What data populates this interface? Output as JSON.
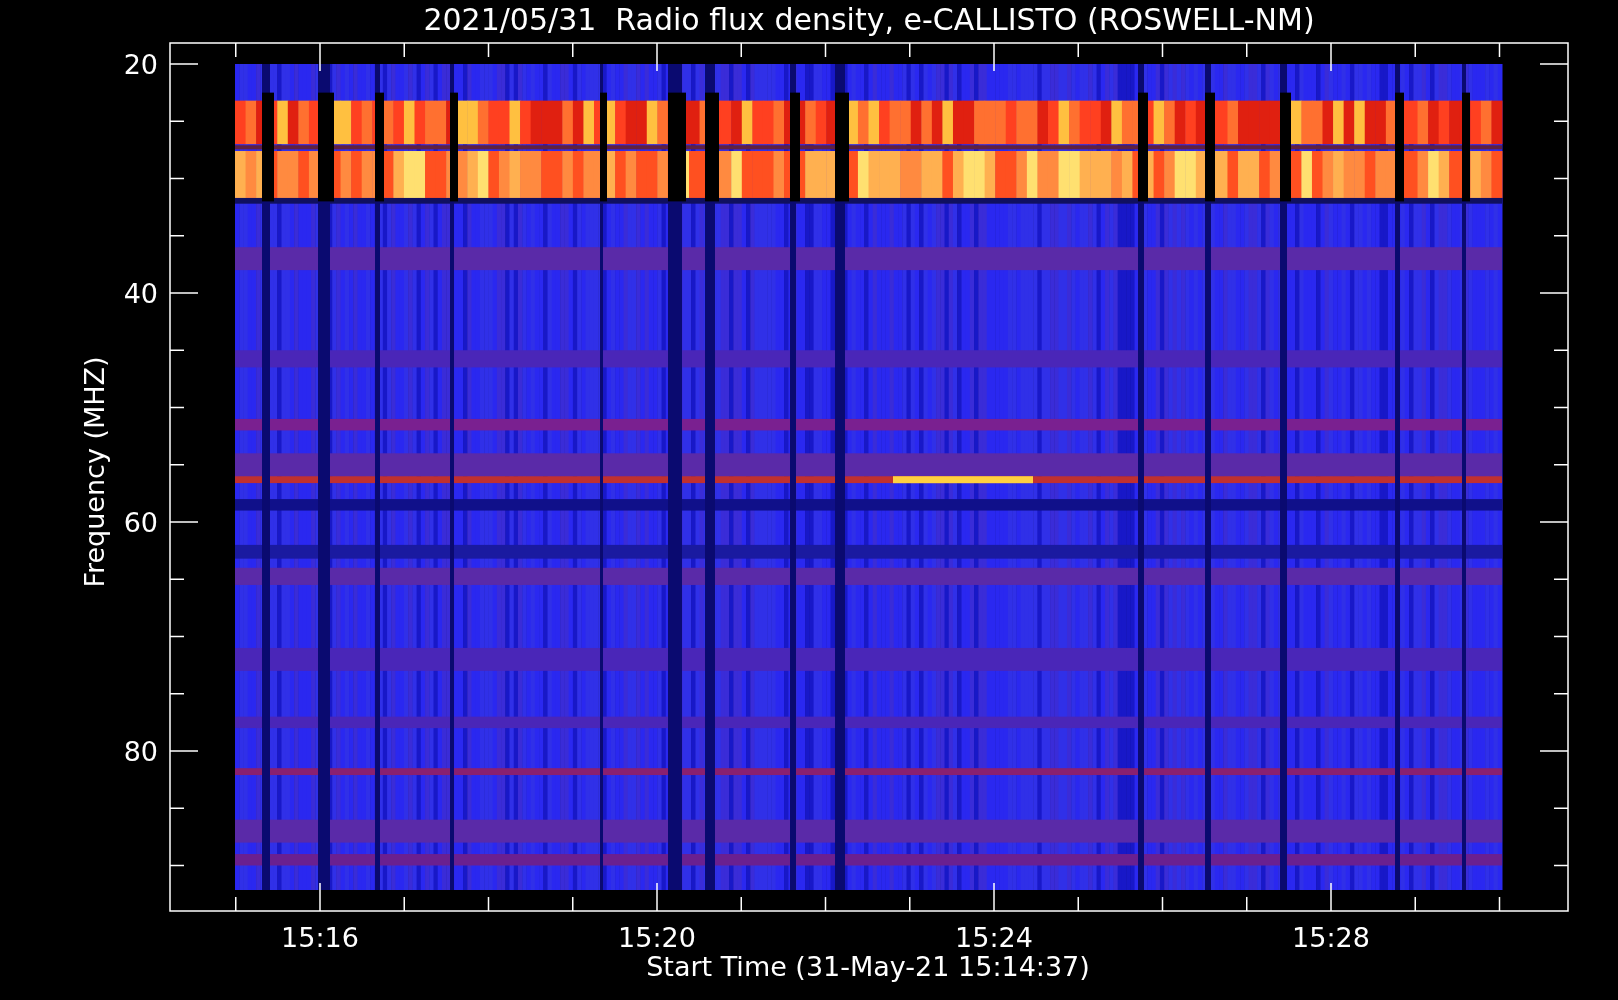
{
  "title": "2021/05/31  Radio flux density, e-CALLISTO (ROSWELL-NM)",
  "y_axis": {
    "label": "Frequency (MHZ)",
    "ticks": [
      "20",
      "40",
      "60",
      "80"
    ]
  },
  "x_axis": {
    "label": "Start Time (31-May-21 15:14:37)",
    "ticks": [
      "15:16",
      "15:20",
      "15:24",
      "15:28"
    ]
  }
}
